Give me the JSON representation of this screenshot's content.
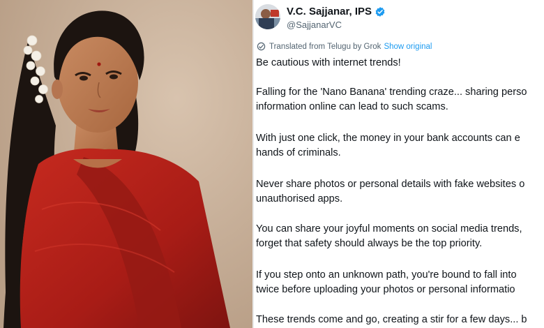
{
  "tweet": {
    "display_name": "V.C. Sajjanar, IPS",
    "handle": "@SajjanarVC",
    "translated_note": "Translated from Telugu by Grok",
    "show_original": "Show original",
    "paragraphs": [
      {
        "lines": [
          "Be cautious with internet trends!"
        ]
      },
      {
        "lines": [
          "Falling for the 'Nano Banana' trending craze... sharing perso",
          "information online can lead to such scams."
        ]
      },
      {
        "lines": [
          "With just one click, the money in your bank accounts can e",
          "hands of criminals."
        ]
      },
      {
        "lines": [
          "Never share photos or personal details with fake websites o",
          "unauthorised apps."
        ]
      },
      {
        "lines": [
          "You can share your joyful moments on social media trends,",
          "forget that safety should always be the top priority."
        ]
      },
      {
        "lines": [
          "If you step onto an unknown path, you're bound to fall into",
          "twice before uploading your photos or personal informatio"
        ]
      },
      {
        "lines": [
          "These trends come and go, creating a stir for a few days... b"
        ]
      }
    ]
  },
  "colors": {
    "accent_blue": "#1d9bf0",
    "saree_red": "#b3211b",
    "text_primary": "#0f1419",
    "text_secondary": "#536471"
  },
  "icons": {
    "verified": "verified-badge-icon",
    "translate": "translate-globe-icon"
  }
}
